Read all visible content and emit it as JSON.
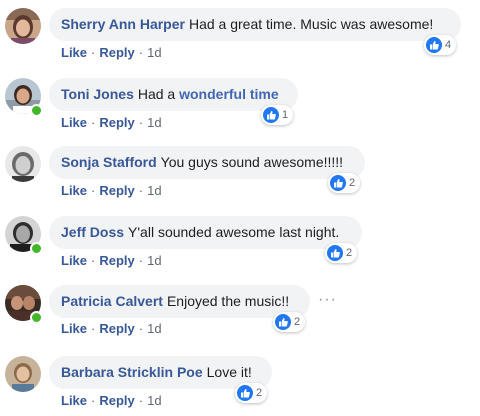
{
  "actions": {
    "like": "Like",
    "reply": "Reply",
    "separator": "·"
  },
  "colors": {
    "author_name": "#385898",
    "bubble_bg": "#f2f3f5",
    "like_blue": "#2078f4",
    "online_green": "#42b72a"
  },
  "comments": [
    {
      "author": "Sherry Ann Harper",
      "text": "Had a great time. Music was awesome!",
      "reactions": "4",
      "time": "1d",
      "online": false
    },
    {
      "author": "Toni Jones",
      "text": "Had a ",
      "link_text": "wonderful time",
      "reactions": "1",
      "time": "1d",
      "online": true
    },
    {
      "author": "Sonja Stafford",
      "text": "You guys sound awesome!!!!!",
      "reactions": "2",
      "time": "1d",
      "online": false
    },
    {
      "author": "Jeff Doss",
      "text": "Y'all sounded awesome last night.",
      "reactions": "2",
      "time": "1d",
      "online": true
    },
    {
      "author": "Patricia Calvert",
      "text": "Enjoyed the music!!",
      "reactions": "2",
      "time": "1d",
      "online": true,
      "more_options": "···"
    },
    {
      "author": "Barbara Stricklin Poe",
      "text": "Love it!",
      "reactions": "2",
      "time": "1d",
      "online": false
    }
  ]
}
